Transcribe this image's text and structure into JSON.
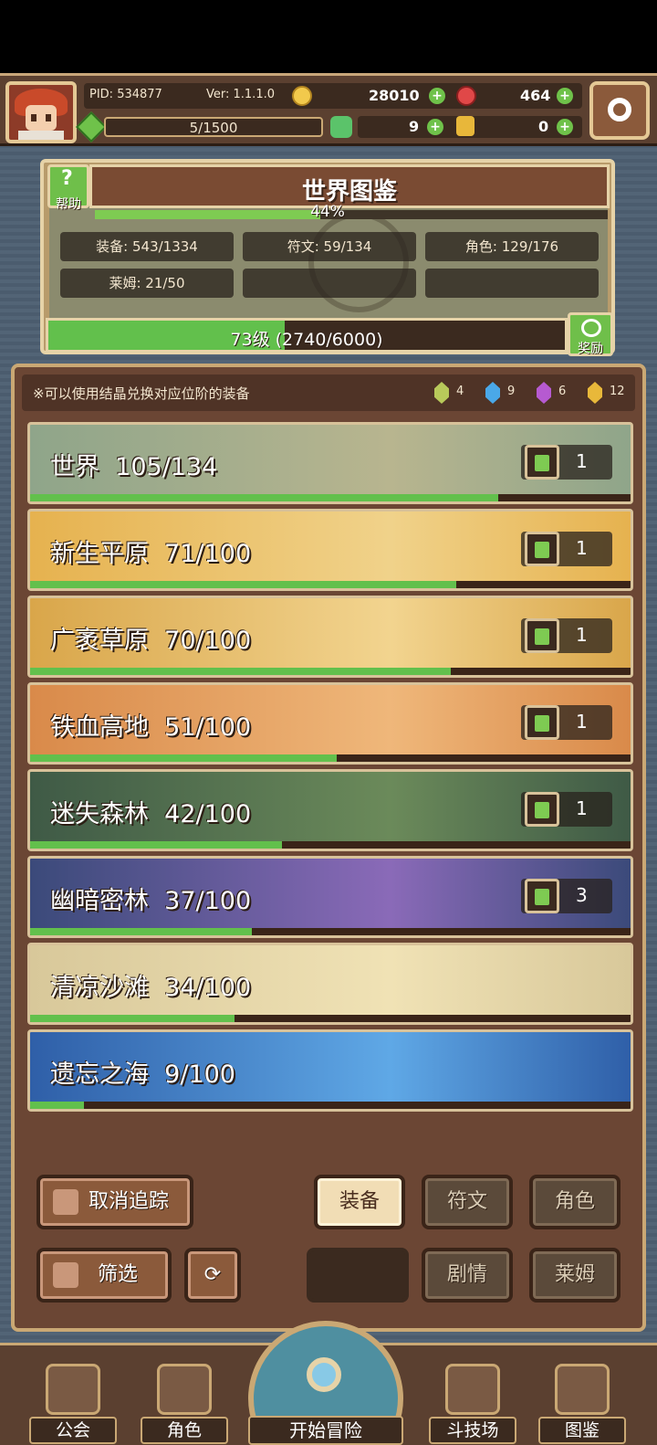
{
  "header": {
    "pid": "PID: 534877",
    "version": "Ver: 1.1.1.0",
    "gold": "28010",
    "gems": "464",
    "stamina": "5/1500",
    "clover": "9",
    "keys": "0"
  },
  "world": {
    "help_label": "帮助",
    "title": "世界图鉴",
    "percent_label": "44%",
    "percent": 44,
    "stats": {
      "equipment": "装备: 543/1334",
      "runes": "符文: 59/134",
      "characters": "角色: 129/176",
      "slimes": "莱姆: 21/50"
    },
    "level_text": "73级  (2740/6000)",
    "level_progress": 0.457,
    "reward_label": "奖励"
  },
  "notice": {
    "text": "※可以使用结晶兑换对应位阶的装备",
    "crystals": [
      {
        "color": "#b8c95a",
        "count": "4"
      },
      {
        "color": "#4aa8e8",
        "count": "9"
      },
      {
        "color": "#b65ad1",
        "count": "6"
      },
      {
        "color": "#e8b83a",
        "count": "12"
      }
    ]
  },
  "areas": [
    {
      "name": "世界  105/134",
      "progress": 0.78,
      "likes": "1",
      "bg": "#8fa58a",
      "bg2": "#b8b58f"
    },
    {
      "name": "新生平原  71/100",
      "progress": 0.71,
      "likes": "1",
      "bg": "#e6b24f",
      "bg2": "#f0d28a"
    },
    {
      "name": "广袤草原  70/100",
      "progress": 0.7,
      "likes": "1",
      "bg": "#d9a64a",
      "bg2": "#f2d48f"
    },
    {
      "name": "铁血高地  51/100",
      "progress": 0.51,
      "likes": "1",
      "bg": "#d98a4a",
      "bg2": "#efb77a"
    },
    {
      "name": "迷失森林  42/100",
      "progress": 0.42,
      "likes": "1",
      "bg": "#3f5a46",
      "bg2": "#6b8a5a"
    },
    {
      "name": "幽暗密林  37/100",
      "progress": 0.37,
      "likes": "3",
      "bg": "#3b4a7a",
      "bg2": "#8a6ab8"
    },
    {
      "name": "清凉沙滩  34/100",
      "progress": 0.34,
      "likes": "",
      "bg": "#d8c89a",
      "bg2": "#f0e2b5"
    },
    {
      "name": "遗忘之海  9/100",
      "progress": 0.09,
      "likes": "",
      "bg": "#2f5fa8",
      "bg2": "#5fa8e6"
    }
  ],
  "buttons": {
    "untrack": "取消追踪",
    "filter": "筛选",
    "equipment": "装备",
    "runes": "符文",
    "characters": "角色",
    "story": "剧情",
    "slimes": "莱姆"
  },
  "nav": {
    "guild": "公会",
    "character": "角色",
    "start": "开始冒险",
    "arena": "斗技场",
    "codex": "图鉴"
  }
}
